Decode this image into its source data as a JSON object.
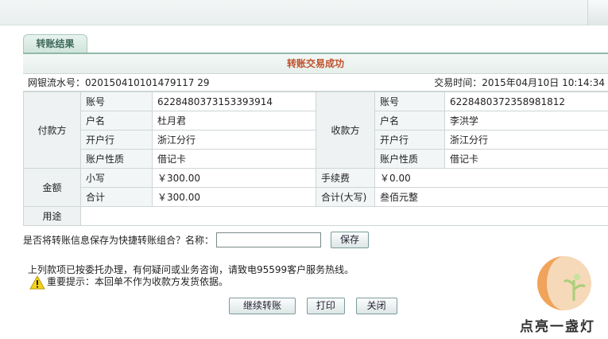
{
  "tab": {
    "label": "转账结果"
  },
  "title": "转账交易成功",
  "info": {
    "serial_label": "网银流水号：",
    "serial_value": "020150410101479117 29",
    "time_label": "交易时间：",
    "time_value": "2015年04月10日 10:14:34"
  },
  "payer": {
    "heading": "付款方",
    "rows": [
      {
        "label": "账号",
        "value": "6228480373153393914"
      },
      {
        "label": "户名",
        "value": "杜月君"
      },
      {
        "label": "开户行",
        "value": "浙江分行"
      },
      {
        "label": "账户性质",
        "value": "借记卡"
      }
    ]
  },
  "payee": {
    "heading": "收款方",
    "rows": [
      {
        "label": "账号",
        "value": "6228480372358981812"
      },
      {
        "label": "户名",
        "value": "李洪学"
      },
      {
        "label": "开户行",
        "value": "浙江分行"
      },
      {
        "label": "账户性质",
        "value": "借记卡"
      }
    ]
  },
  "amount": {
    "heading": "金额",
    "small_label": "小写",
    "small_value": "￥300.00",
    "fee_label": "手续费",
    "fee_value": "￥0.00",
    "total_label": "合计",
    "total_value": "￥300.00",
    "total_big_label": "合计(大写)",
    "total_big_value": "叁佰元整"
  },
  "purpose": {
    "heading": "用途",
    "value": ""
  },
  "save": {
    "prompt": "是否将转账信息保存为快捷转账组合？名称：",
    "name_value": "",
    "button": "保存"
  },
  "notice": "上列款项已按委托办理，有何疑问或业务咨询，请致电95599客户服务热线。",
  "warning": "重要提示：本回单不作为收款方发货依据。",
  "buttons": {
    "continue": "继续转账",
    "print": "打印",
    "close": "关闭"
  },
  "watermark": {
    "text": "点亮一盏灯"
  },
  "colors": {
    "title": "#c0502b",
    "tab_text": "#3e6a5b",
    "accent": "#8fbaa8"
  }
}
